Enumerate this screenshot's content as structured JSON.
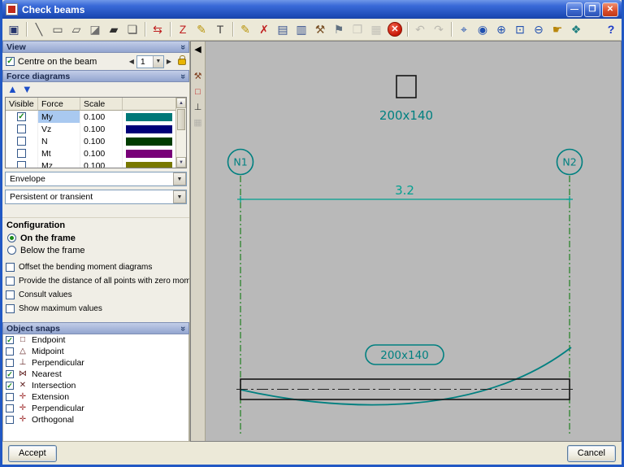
{
  "window": {
    "title": "Check beams",
    "controls": {
      "minimize": "—",
      "maximize": "❐",
      "close": "✕"
    }
  },
  "icons": {
    "left_arrow": "◀",
    "right_arrow": "▶",
    "down_arrow": "▼",
    "up_arrow": "▲",
    "check": "✓",
    "chevron": "»",
    "help": "?"
  },
  "toolbar": {
    "items": [
      {
        "name": "save-icon",
        "glyph": "▣",
        "color": "#26356e"
      },
      {
        "sep": true
      },
      {
        "name": "draw-line-icon",
        "glyph": "╲",
        "color": "#505050"
      },
      {
        "name": "draw-rectangle-icon",
        "glyph": "▭",
        "color": "#505050"
      },
      {
        "name": "edit-polygon-icon",
        "glyph": "▱",
        "color": "#505050"
      },
      {
        "name": "erase-icon",
        "glyph": "◪",
        "color": "#707070"
      },
      {
        "name": "filled-section-icon",
        "glyph": "▰",
        "color": "#303030"
      },
      {
        "name": "edit-detail-icon",
        "glyph": "❏",
        "color": "#505050"
      },
      {
        "sep": true
      },
      {
        "name": "dimension-icon",
        "glyph": "⇆",
        "color": "#c02020"
      },
      {
        "sep": true
      },
      {
        "name": "edit-depth-icon",
        "glyph": "Z",
        "color": "#c02020"
      },
      {
        "name": "annotate-icon",
        "glyph": "✎",
        "color": "#b8940a"
      },
      {
        "name": "text-icon",
        "glyph": "T",
        "color": "#404040"
      },
      {
        "sep": true
      },
      {
        "name": "pencil-icon",
        "glyph": "✎",
        "color": "#b8940a"
      },
      {
        "name": "delete-annotation-icon",
        "glyph": "✗",
        "color": "#c02020"
      },
      {
        "name": "notebook-icon",
        "glyph": "▤",
        "color": "#36508e"
      },
      {
        "name": "report-icon",
        "glyph": "▥",
        "color": "#36508e"
      },
      {
        "name": "tools-icon",
        "glyph": "⚒",
        "color": "#7a5228"
      },
      {
        "name": "flag-icon",
        "glyph": "⚑",
        "color": "#607080"
      },
      {
        "name": "comment-icon",
        "glyph": "❐",
        "color": "#909090",
        "disabled": true
      },
      {
        "name": "print-icon",
        "glyph": "▦",
        "color": "#909090",
        "disabled": true
      },
      {
        "name": "cancel-icon",
        "glyph": "✕",
        "color": "#ffffff",
        "red_badge": true
      },
      {
        "sep": true
      },
      {
        "name": "undo-icon",
        "glyph": "↶",
        "color": "#808080",
        "disabled": true
      },
      {
        "name": "redo-icon",
        "glyph": "↷",
        "color": "#808080",
        "disabled": true
      },
      {
        "sep": true
      },
      {
        "name": "zoom-window-icon",
        "glyph": "⌖",
        "color": "#2050b0"
      },
      {
        "name": "zoom-dynamic-icon",
        "glyph": "◉",
        "color": "#2050b0"
      },
      {
        "name": "zoom-in-icon",
        "glyph": "⊕",
        "color": "#2050b0"
      },
      {
        "name": "zoom-extents-icon",
        "glyph": "⊡",
        "color": "#2050b0"
      },
      {
        "name": "zoom-out-icon",
        "glyph": "⊖",
        "color": "#2050b0"
      },
      {
        "name": "pan-icon",
        "glyph": "☛",
        "color": "#b8860b"
      },
      {
        "name": "redraw-icon",
        "glyph": "❖",
        "color": "#208080"
      }
    ]
  },
  "side_tools": {
    "items": [
      {
        "name": "pointer-icon",
        "glyph": "◀",
        "color": "#000000"
      },
      {
        "name": "tools-icon",
        "glyph": "⚒",
        "color": "#804020",
        "gap": true
      },
      {
        "name": "section-icon",
        "glyph": "□",
        "color": "#c02020"
      },
      {
        "name": "perpendicular-icon",
        "glyph": "⊥",
        "color": "#303030"
      },
      {
        "name": "grid-icon",
        "glyph": "▦",
        "color": "#909090",
        "disabled": true
      }
    ]
  },
  "panel": {
    "view": {
      "header": "View",
      "centre_label": "Centre on the beam",
      "centre_checked": true,
      "spinner_value": "1"
    },
    "force_diagrams": {
      "header": "Force diagrams",
      "columns": [
        "Visible",
        "Force",
        "Scale"
      ],
      "rows": [
        {
          "visible": true,
          "force": "My",
          "scale": "0.100",
          "color": "#007878",
          "selected": true
        },
        {
          "visible": false,
          "force": "Vz",
          "scale": "0.100",
          "color": "#000078"
        },
        {
          "visible": false,
          "force": "N",
          "scale": "0.100",
          "color": "#003c00"
        },
        {
          "visible": false,
          "force": "Mt",
          "scale": "0.100",
          "color": "#780078"
        },
        {
          "visible": false,
          "force": "Mz",
          "scale": "0.100",
          "color": "#787800"
        }
      ],
      "combo_envelope": "Envelope",
      "combo_case": "Persistent or transient"
    },
    "configuration": {
      "header": "Configuration",
      "radios": [
        {
          "label": "On the frame",
          "selected": true
        },
        {
          "label": "Below the frame",
          "selected": false
        }
      ],
      "checkboxes": [
        {
          "label": "Offset the bending moment diagrams",
          "checked": false
        },
        {
          "label": "Provide the distance of all points with zero moment",
          "checked": false
        },
        {
          "label": "Consult values",
          "checked": false
        },
        {
          "label": "Show maximum values",
          "checked": false
        }
      ]
    },
    "object_snaps": {
      "header": "Object snaps",
      "items": [
        {
          "label": "Endpoint",
          "checked": true,
          "glyph": "□",
          "color": "#602020"
        },
        {
          "label": "Midpoint",
          "checked": false,
          "glyph": "△",
          "color": "#602020"
        },
        {
          "label": "Perpendicular",
          "checked": false,
          "glyph": "⊥",
          "color": "#602020"
        },
        {
          "label": "Nearest",
          "checked": true,
          "glyph": "⋈",
          "color": "#602020"
        },
        {
          "label": "Intersection",
          "checked": true,
          "glyph": "✕",
          "color": "#602020"
        },
        {
          "label": "Extension",
          "checked": false,
          "glyph": "✛",
          "color": "#a03030"
        },
        {
          "label": "Perpendicular",
          "checked": false,
          "glyph": "✛",
          "color": "#a03030"
        },
        {
          "label": "Orthogonal",
          "checked": false,
          "glyph": "✛",
          "color": "#a03030"
        }
      ]
    }
  },
  "canvas": {
    "section_label": "200x140",
    "beam_label": "200x140",
    "node_left": "N1",
    "node_right": "N2",
    "span_dimension": "3.2",
    "colors": {
      "teal": "#008080",
      "dimension": "#00a090",
      "green_dash": "#208020",
      "background": "#b9b9b9"
    }
  },
  "footer": {
    "accept_label": "Accept",
    "cancel_label": "Cancel"
  }
}
